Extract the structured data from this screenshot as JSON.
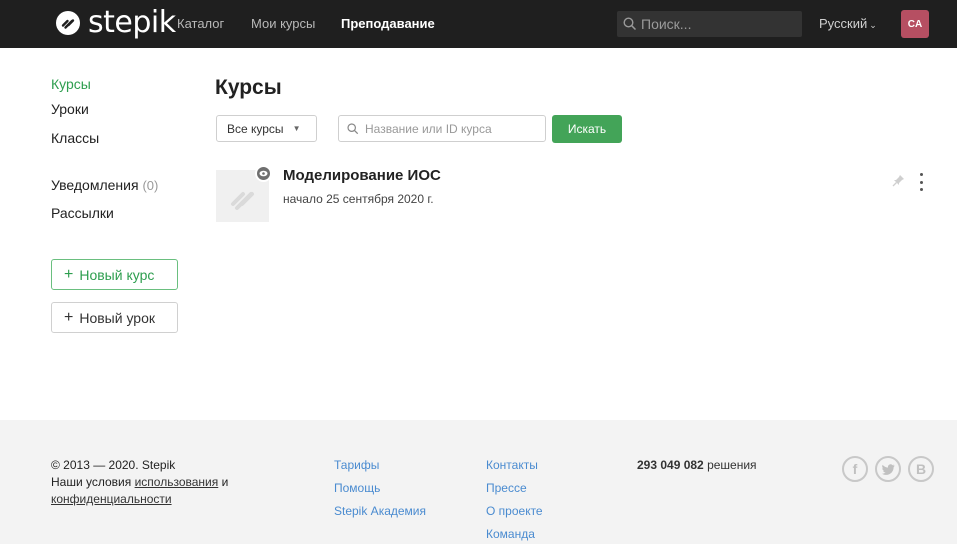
{
  "header": {
    "logo_text": "stepik",
    "nav": [
      "Каталог",
      "Мои курсы",
      "Преподавание"
    ],
    "search_placeholder": "Поиск...",
    "language": "Русский",
    "avatar_initials": "CA"
  },
  "sidebar": {
    "items": [
      {
        "label": "Курсы"
      },
      {
        "label": "Уроки"
      },
      {
        "label": "Классы"
      },
      {
        "label": "Уведомления",
        "count": "(0)"
      },
      {
        "label": "Рассылки"
      }
    ],
    "new_course": "Новый курс",
    "new_lesson": "Новый урок"
  },
  "main": {
    "title": "Курсы",
    "filter": "Все курсы",
    "search_placeholder": "Название или ID курса",
    "search_button": "Искать",
    "course": {
      "title": "Моделирование ИОС",
      "date": "начало 25 сентября 2020 г."
    }
  },
  "footer": {
    "copyright": "© 2013 — 2020. Stepik",
    "terms_prefix": "Наши условия ",
    "terms_link": "использования",
    "terms_and": " и",
    "privacy_link": "конфиденциальности",
    "col1": [
      "Тарифы",
      "Помощь",
      "Stepik Академия"
    ],
    "col2": [
      "Контакты",
      "Прессе",
      "О проекте",
      "Команда"
    ],
    "stat_number": "293 049 082",
    "stat_label": " решения",
    "social": [
      "f",
      "t",
      "B"
    ]
  },
  "colors": {
    "header_bg": "#1f1f1f",
    "accent_green": "#43a458",
    "avatar_bg": "#b64f62",
    "link_blue": "#4a8bd0"
  }
}
